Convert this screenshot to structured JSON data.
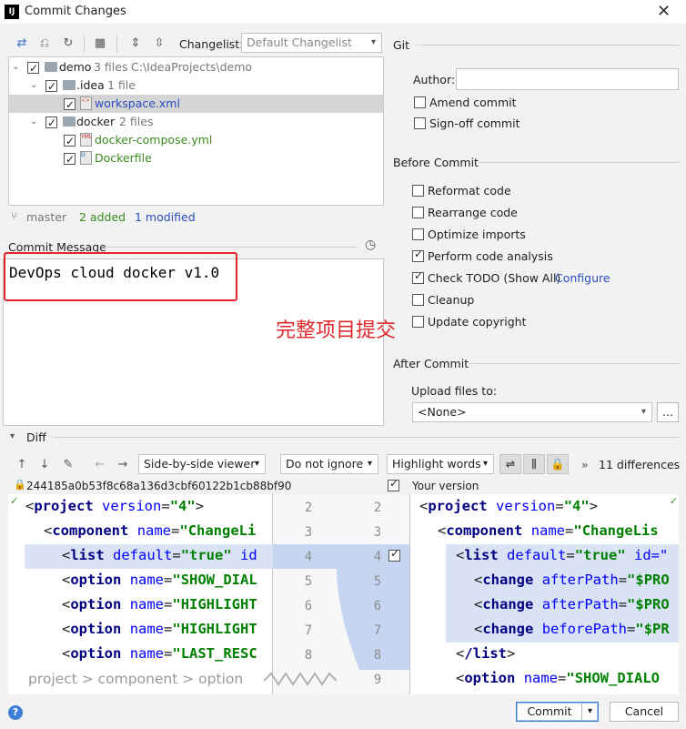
{
  "window": {
    "title": "Commit Changes",
    "icon_letters": "IJ"
  },
  "toolbar": {
    "changelist_label": "Changelist:",
    "changelist_value": "Default Changelist"
  },
  "tree": {
    "root": {
      "name": "demo",
      "count": "3 files",
      "path": "C:\\IdeaProjects\\demo"
    },
    "idea": {
      "name": ".idea",
      "count": "1 file"
    },
    "workspace": {
      "name": "workspace.xml"
    },
    "docker": {
      "name": "docker",
      "count": "2 files"
    },
    "compose": {
      "name": "docker-compose.yml"
    },
    "dockerfile": {
      "name": "Dockerfile"
    }
  },
  "status": {
    "branch": "master",
    "added": "2 added",
    "modified": "1 modified"
  },
  "commit_message": {
    "label": "Commit Message",
    "text": "DevOps cloud docker v1.0"
  },
  "annotation": "完整项目提交",
  "git": {
    "section": "Git",
    "author_label": "Author:",
    "author_value": "",
    "amend": "Amend commit",
    "signoff": "Sign-off commit"
  },
  "before_commit": {
    "section": "Before Commit",
    "reformat": "Reformat code",
    "rearrange": "Rearrange code",
    "optimize": "Optimize imports",
    "analysis": "Perform code analysis",
    "todo": "Check TODO (Show All)",
    "configure": "Configure",
    "cleanup": "Cleanup",
    "copyright": "Update copyright"
  },
  "after_commit": {
    "section": "After Commit",
    "upload_label": "Upload files to:",
    "upload_value": "<None>",
    "browse": "..."
  },
  "diff": {
    "title": "Diff",
    "viewer": "Side-by-side viewer",
    "ignore": "Do not ignore",
    "highlight": "Highlight words",
    "differences": "11 differences",
    "hash": "244185a0b53f8c68a136d3cbf60122b1cb88bf90",
    "your_version": "Your version",
    "breadcrumb": "project > component > option",
    "left_lines": [
      {
        "tag": "project",
        "attr": "version",
        "val": "\"4\"",
        "end": ">"
      },
      {
        "tag": "component",
        "attr": "name",
        "val": "\"ChangeLi",
        "end": ""
      },
      {
        "tag": "list",
        "attr": "default",
        "val": "\"true\"",
        "end": " id"
      },
      {
        "tag": "option",
        "attr": "name",
        "val": "\"SHOW_DIAL",
        "end": ""
      },
      {
        "tag": "option",
        "attr": "name",
        "val": "\"HIGHLIGHT",
        "end": ""
      },
      {
        "tag": "option",
        "attr": "name",
        "val": "\"HIGHLIGHT",
        "end": ""
      },
      {
        "tag": "option",
        "attr": "name",
        "val": "\"LAST_RESC",
        "end": ""
      }
    ],
    "left_nums": [
      "2",
      "3",
      "4",
      "5",
      "6",
      "7",
      "8"
    ],
    "right_nums": [
      "2",
      "3",
      "4",
      "5",
      "6",
      "7",
      "8",
      "9"
    ],
    "right_lines": [
      {
        "tag": "project",
        "attr": "version",
        "val": "\"4\"",
        "end": ">"
      },
      {
        "tag": "component",
        "attr": "name",
        "val": "\"ChangeLis",
        "end": ""
      },
      {
        "tag": "list",
        "attr": "default",
        "val": "\"true\"",
        "end": " id=\""
      },
      {
        "tag": "change",
        "attr": "afterPath",
        "val": "\"$PRO",
        "end": ""
      },
      {
        "tag": "change",
        "attr": "afterPath",
        "val": "\"$PRO",
        "end": ""
      },
      {
        "tag": "change",
        "attr": "beforePath",
        "val": "\"$PR",
        "end": ""
      },
      {
        "tag": "/list",
        "attr": "",
        "val": "",
        "end": ">"
      },
      {
        "tag": "option",
        "attr": "name",
        "val": "\"SHOW_DIALO",
        "end": ""
      }
    ]
  },
  "buttons": {
    "commit": "Commit",
    "cancel": "Cancel",
    "help": "?"
  }
}
